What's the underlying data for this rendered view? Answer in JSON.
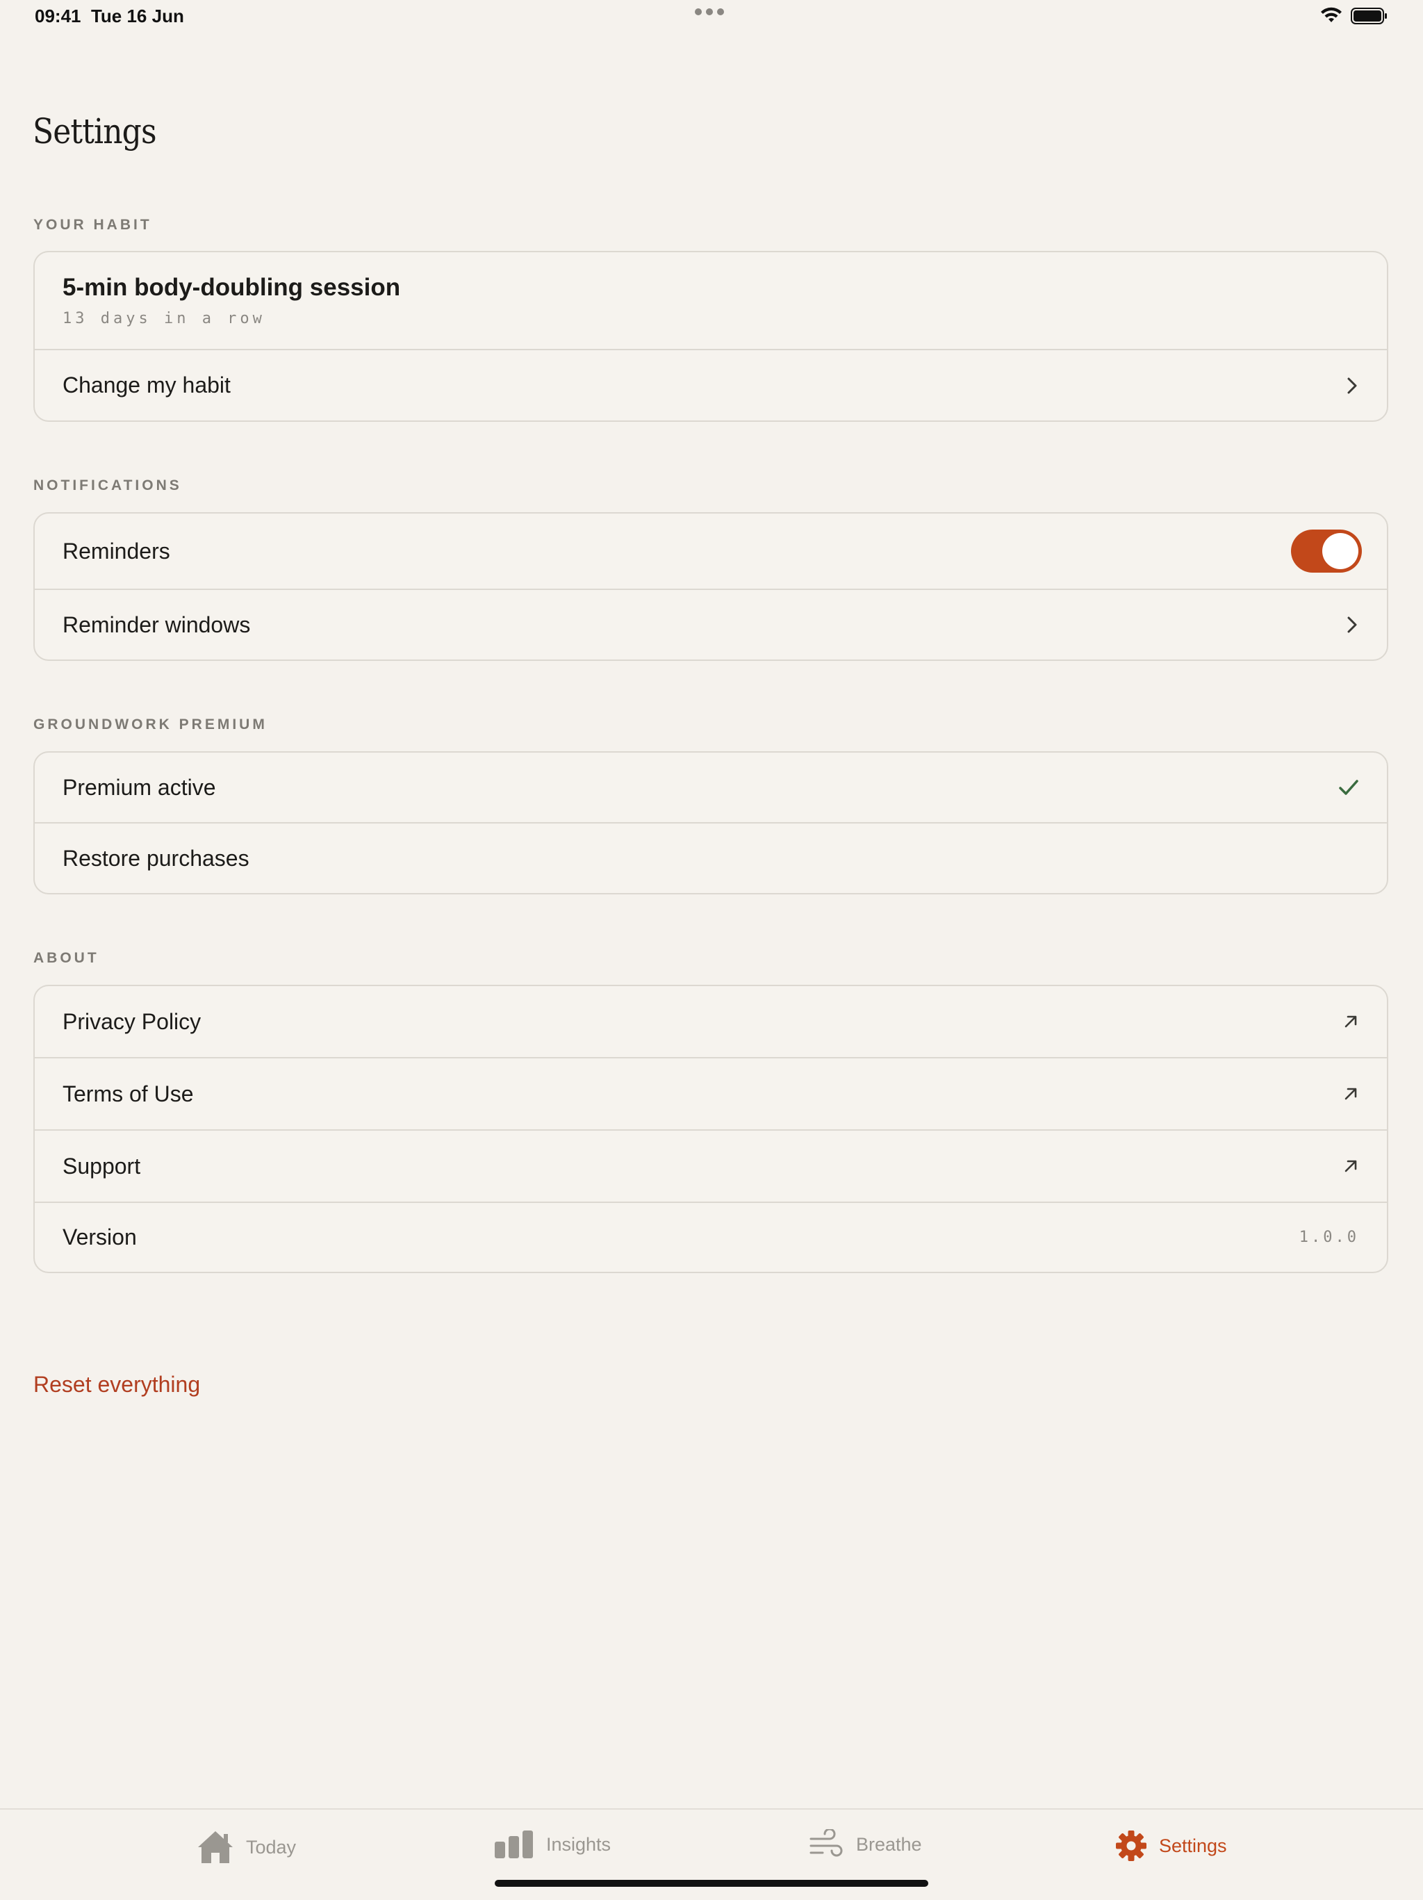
{
  "status": {
    "time": "09:41",
    "date": "Tue 16 Jun"
  },
  "page": {
    "title": "Settings"
  },
  "sections": {
    "habit": {
      "label": "YOUR HABIT",
      "habit_title": "5-min body-doubling session",
      "habit_streak": "13 days in a row",
      "change_label": "Change my habit"
    },
    "notifications": {
      "label": "NOTIFICATIONS",
      "reminders_label": "Reminders",
      "reminders_on": true,
      "windows_label": "Reminder windows"
    },
    "premium": {
      "label": "GROUNDWORK PREMIUM",
      "active_label": "Premium active",
      "restore_label": "Restore purchases"
    },
    "about": {
      "label": "ABOUT",
      "privacy_label": "Privacy Policy",
      "terms_label": "Terms of Use",
      "support_label": "Support",
      "version_label": "Version",
      "version_value": "1.0.0"
    }
  },
  "reset_label": "Reset everything",
  "tabs": [
    {
      "label": "Today",
      "icon": "house-icon",
      "active": false
    },
    {
      "label": "Insights",
      "icon": "bar-chart-icon",
      "active": false
    },
    {
      "label": "Breathe",
      "icon": "wind-icon",
      "active": false
    },
    {
      "label": "Settings",
      "icon": "gear-icon",
      "active": true
    }
  ],
  "colors": {
    "accent": "#c2481a",
    "destructive": "#b13e20",
    "check": "#3a6b3f",
    "background": "#f5f2ed"
  }
}
